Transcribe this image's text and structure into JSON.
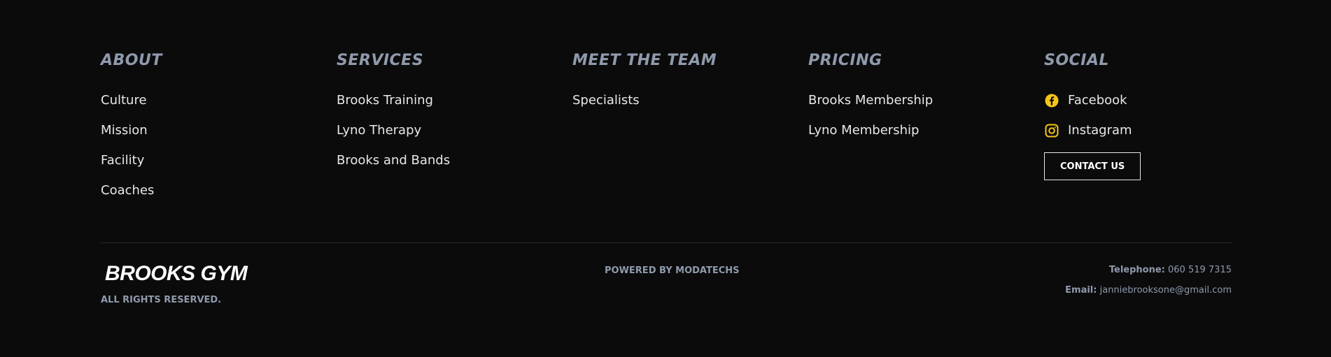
{
  "columns": [
    {
      "title": "ABOUT",
      "links": [
        "Culture",
        "Mission",
        "Facility",
        "Coaches"
      ]
    },
    {
      "title": "SERVICES",
      "links": [
        "Brooks Training",
        "Lyno Therapy",
        "Brooks and Bands"
      ]
    },
    {
      "title": "MEET THE TEAM",
      "links": [
        "Specialists"
      ]
    },
    {
      "title": "PRICING",
      "links": [
        "Brooks Membership",
        "Lyno Membership"
      ]
    },
    {
      "title": "SOCIAL",
      "links": [
        {
          "label": "Facebook",
          "icon": "facebook-icon"
        },
        {
          "label": "Instagram",
          "icon": "instagram-icon"
        }
      ],
      "button": "CONTACT US"
    }
  ],
  "bottom": {
    "brand": "BROOKS GYM",
    "rights": "ALL RIGHTS RESERVED.",
    "powered": "POWERED BY MODATECHS",
    "telephone_label": "Telephone:",
    "telephone": "060 519 7315",
    "email_label": "Email:",
    "email": "janniebrooksone@gmail.com"
  },
  "colors": {
    "background": "#0b0b0c",
    "heading": "#8f9aab",
    "link": "#e8e8e8",
    "icon_accent": "#f5c518",
    "divider": "#2a2a2c"
  }
}
